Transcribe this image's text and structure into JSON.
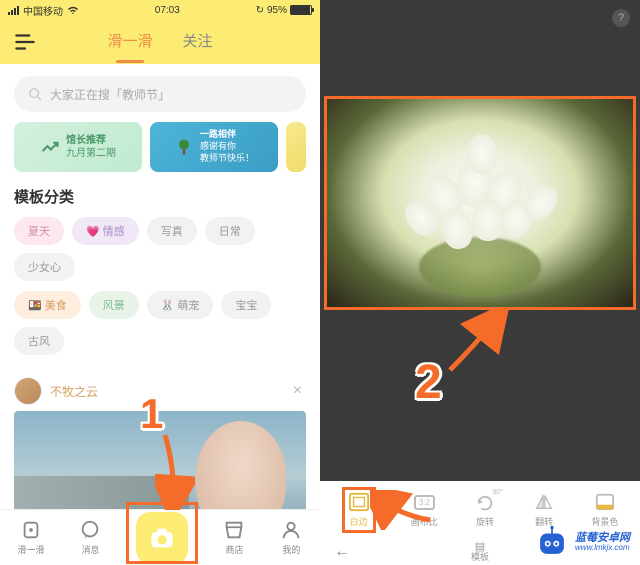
{
  "status": {
    "carrier": "中国移动",
    "wifi": "wifi",
    "time": "07:03",
    "sync": "sync",
    "battery_pct": "95%"
  },
  "header": {
    "tabs": [
      {
        "label": "滑一滑",
        "active": true
      },
      {
        "label": "关注",
        "active": false
      }
    ]
  },
  "search": {
    "placeholder": "大家正在搜「教师节」"
  },
  "promos": [
    {
      "line1": "馆长推荐",
      "line2": "九月第二期",
      "icon": "chart-up"
    },
    {
      "line1": "一路相伴",
      "line2": "感谢有你",
      "line3": "教师节快乐！",
      "icon": "tree"
    }
  ],
  "section_title": "模板分类",
  "pills": {
    "row1": [
      {
        "label": "夏天",
        "style": "pink"
      },
      {
        "emoji": "💗",
        "label": "情感",
        "style": "purple"
      },
      {
        "label": "写真",
        "style": "gray"
      },
      {
        "label": "日常",
        "style": "gray"
      },
      {
        "label": "少女心",
        "style": "gray"
      }
    ],
    "row2": [
      {
        "emoji": "🍱",
        "label": "美食",
        "style": "orange"
      },
      {
        "label": "风景",
        "style": "green"
      },
      {
        "emoji": "🐰",
        "label": "萌宠",
        "style": "gray"
      },
      {
        "label": "宝宝",
        "style": "gray"
      },
      {
        "label": "古风",
        "style": "gray"
      }
    ]
  },
  "user_post": {
    "name": "不牧之云"
  },
  "nav": [
    {
      "label": "滑一滑",
      "icon": "scroll"
    },
    {
      "label": "消息",
      "icon": "message"
    },
    {
      "label": "",
      "icon": "camera"
    },
    {
      "label": "商店",
      "icon": "store"
    },
    {
      "label": "我的",
      "icon": "profile"
    }
  ],
  "right_tools": [
    {
      "label": "白边",
      "icon": "border",
      "active": true
    },
    {
      "label": "画布比",
      "icon": "ratio",
      "ratio_text": "3:2"
    },
    {
      "label": "旋转",
      "icon": "rotate",
      "badge": "90°"
    },
    {
      "label": "翻转",
      "icon": "flip"
    },
    {
      "label": "背景色",
      "icon": "bgcolor"
    }
  ],
  "right_bottom": {
    "label": "模板"
  },
  "callouts": {
    "one": "1",
    "two": "2"
  },
  "watermark": {
    "line1": "蓝莓安卓网",
    "line2": "www.lmkjx.com"
  },
  "accent": "#f56b2a"
}
